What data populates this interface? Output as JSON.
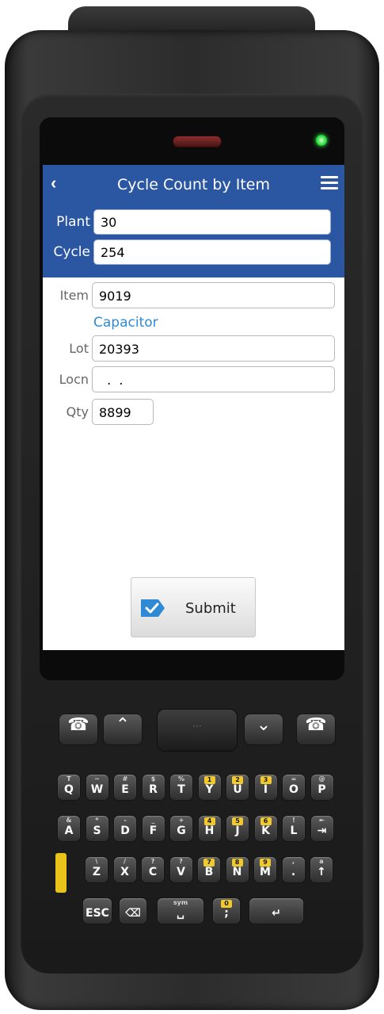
{
  "header": {
    "title": "Cycle Count by Item",
    "back_glyph": "‹",
    "menu_icon": "hamburger-menu-icon"
  },
  "header_fields": [
    {
      "label": "Plant",
      "value": "30"
    },
    {
      "label": "Cycle",
      "value": "254"
    }
  ],
  "form": {
    "item_label": "Item",
    "item_value": "9019",
    "item_description": "Capacitor",
    "lot_label": "Lot",
    "lot_value": "20393",
    "locn_label": "Locn",
    "locn_value": "  .  .",
    "qty_label": "Qty",
    "qty_value": "8899"
  },
  "submit": {
    "label": "Submit",
    "icon": "checkmark-tag-icon",
    "icon_color": "#2f8ad6"
  },
  "colors": {
    "header_bg": "#2b56a2",
    "description": "#2f8ad6",
    "led": "#27d93a"
  },
  "keypad": {
    "nav_center": "···",
    "row1": [
      {
        "main": "Q",
        "sub": "T"
      },
      {
        "main": "W",
        "sub": "~"
      },
      {
        "main": "E",
        "sub": "#"
      },
      {
        "main": "R",
        "sub": "$"
      },
      {
        "main": "T",
        "sub": "%"
      },
      {
        "main": "Y",
        "sub": "1"
      },
      {
        "main": "U",
        "sub": "2"
      },
      {
        "main": "I",
        "sub": "3"
      },
      {
        "main": "O",
        "sub": "="
      },
      {
        "main": "P",
        "sub": "@"
      }
    ],
    "row2": [
      {
        "main": "A",
        "sub": "&"
      },
      {
        "main": "S",
        "sub": "*"
      },
      {
        "main": "D",
        "sub": "-"
      },
      {
        "main": "F",
        "sub": "_"
      },
      {
        "main": "G",
        "sub": "+"
      },
      {
        "main": "H",
        "sub": "4"
      },
      {
        "main": "J",
        "sub": "5"
      },
      {
        "main": "K",
        "sub": "6"
      },
      {
        "main": "L",
        "sub": "!"
      },
      {
        "main": "⇥",
        "sub": "⇤"
      }
    ],
    "row3": [
      {
        "main": "Z",
        "sub": "\\"
      },
      {
        "main": "X",
        "sub": "/"
      },
      {
        "main": "C",
        "sub": "?"
      },
      {
        "main": "V",
        "sub": "?"
      },
      {
        "main": "B",
        "sub": "7"
      },
      {
        "main": "N",
        "sub": "8"
      },
      {
        "main": "M",
        "sub": "9"
      },
      {
        "main": ".",
        "sub": ","
      },
      {
        "main": "↑",
        "sub": "a"
      }
    ],
    "row4": [
      {
        "main": "ESC",
        "sub": ""
      },
      {
        "main": "⌫",
        "sub": ""
      },
      {
        "main": "␣",
        "sub": "sym"
      },
      {
        "main": ";",
        "sub": "0"
      },
      {
        "main": "↵",
        "sub": ""
      }
    ]
  }
}
